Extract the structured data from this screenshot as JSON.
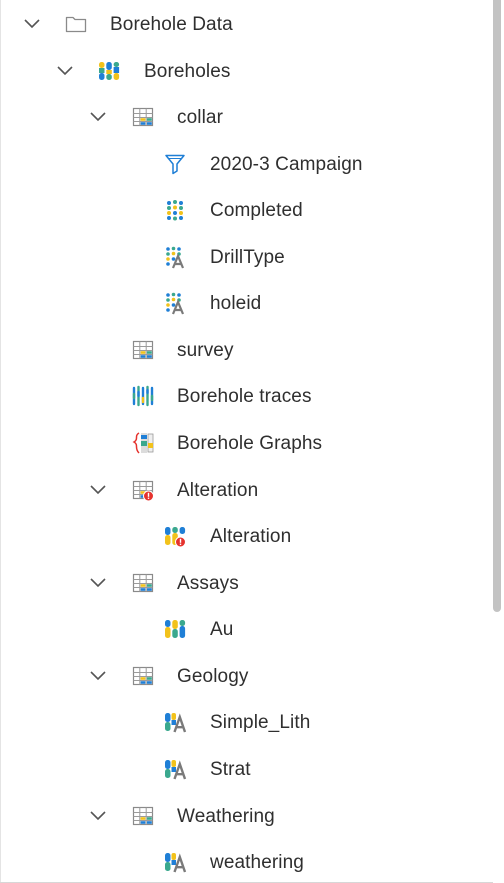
{
  "tree": {
    "root": {
      "label": "Borehole Data",
      "icon": "folder-icon",
      "expanded": true
    },
    "boreholes": {
      "label": "Boreholes",
      "icon": "borehole-columns-icon",
      "expanded": true
    },
    "collar": {
      "label": "collar",
      "icon": "table-icon",
      "expanded": true,
      "children": [
        {
          "label": "2020-3 Campaign",
          "icon": "filter-icon"
        },
        {
          "label": "Completed",
          "icon": "category-dots-icon"
        },
        {
          "label": "DrillType",
          "icon": "category-text-icon"
        },
        {
          "label": "holeid",
          "icon": "category-text-icon"
        }
      ]
    },
    "survey": {
      "label": "survey",
      "icon": "table-icon"
    },
    "traces": {
      "label": "Borehole traces",
      "icon": "borehole-traces-icon"
    },
    "graphs": {
      "label": "Borehole Graphs",
      "icon": "borehole-graphs-icon"
    },
    "alteration_table": {
      "label": "Alteration",
      "icon": "table-error-icon",
      "expanded": true,
      "children": [
        {
          "label": "Alteration",
          "icon": "interval-error-icon"
        }
      ]
    },
    "assays": {
      "label": "Assays",
      "icon": "table-icon",
      "expanded": true,
      "children": [
        {
          "label": "Au",
          "icon": "interval-numeric-icon"
        }
      ]
    },
    "geology": {
      "label": "Geology",
      "icon": "table-icon",
      "expanded": true,
      "children": [
        {
          "label": "Simple_Lith",
          "icon": "interval-category-icon"
        },
        {
          "label": "Strat",
          "icon": "interval-category-icon"
        }
      ]
    },
    "weathering": {
      "label": "Weathering",
      "icon": "table-icon",
      "expanded": true,
      "children": [
        {
          "label": "weathering",
          "icon": "interval-category-icon"
        }
      ]
    }
  },
  "colors": {
    "yellow": "#f2c21b",
    "teal": "#3aa88e",
    "blue": "#1f7fd6",
    "gray": "#8a8a8a",
    "error": "#e5322d",
    "text": "#2f2f2f"
  }
}
